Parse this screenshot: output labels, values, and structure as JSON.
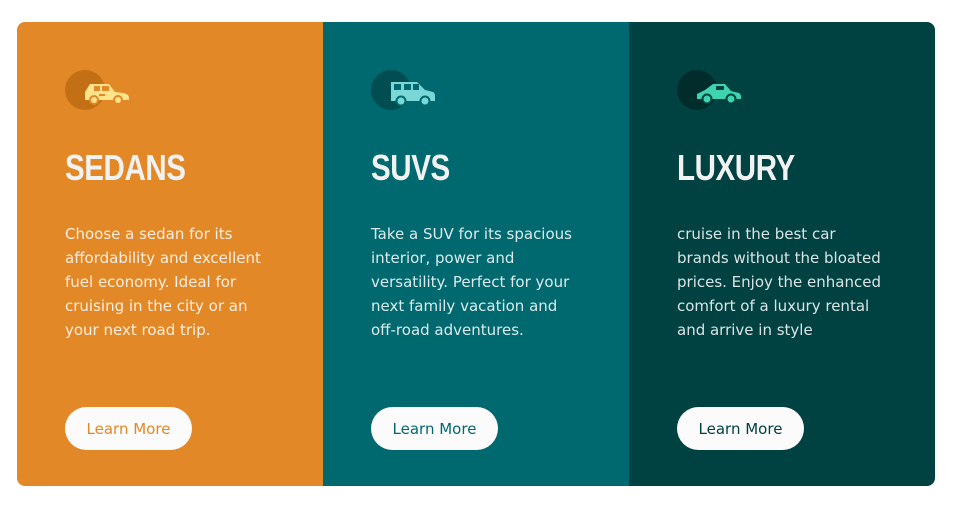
{
  "colors": {
    "sedans": "#e38826",
    "suvs": "#006970",
    "luxury": "#004141",
    "button_bg": "#fbfbfb",
    "heading": "#f2f2f2"
  },
  "cards": [
    {
      "icon": "sedan-car-icon",
      "title": "Sedans",
      "description": "Choose a sedan for its affordability and excellent fuel economy. Ideal for cruising in the city or an your next road trip.",
      "button_label": "Learn More"
    },
    {
      "icon": "suv-car-icon",
      "title": "SUVs",
      "description": "Take a SUV for its spacious interior, power and versatility. Perfect for your next family vacation and off-road adventures.",
      "button_label": "Learn More"
    },
    {
      "icon": "luxury-car-icon",
      "title": "Luxury",
      "description": "cruise in the best car brands without the bloated prices. Enjoy the enhanced comfort of a luxury rental and arrive in style",
      "button_label": "Learn More"
    }
  ]
}
